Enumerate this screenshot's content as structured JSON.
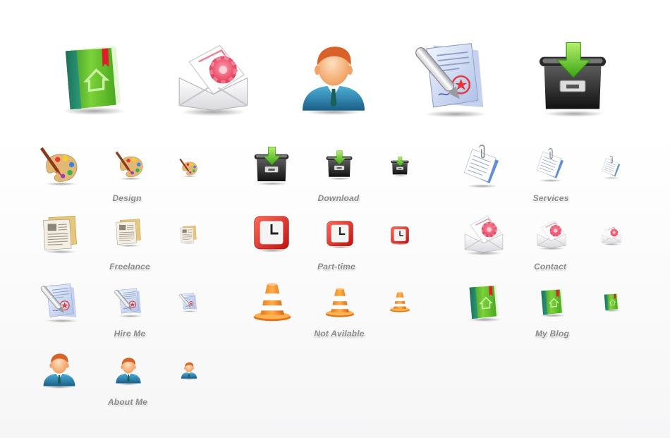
{
  "sheet": {
    "background": "#ffffff",
    "label_color": "#8c8c8c"
  },
  "featured": [
    {
      "icon": "green-book-icon"
    },
    {
      "icon": "envelope-flower-icon"
    },
    {
      "icon": "businessman-icon"
    },
    {
      "icon": "document-pen-icon"
    },
    {
      "icon": "download-box-icon"
    }
  ],
  "groups": [
    {
      "label": "Design",
      "icon": "paint-palette-icon"
    },
    {
      "label": "Download",
      "icon": "download-box-icon"
    },
    {
      "label": "Services",
      "icon": "paper-clip-document-icon"
    },
    {
      "label": "Freelance",
      "icon": "newspaper-icon"
    },
    {
      "label": "Part-time",
      "icon": "clock-icon"
    },
    {
      "label": "Contact",
      "icon": "envelope-flower-icon"
    },
    {
      "label": "Hire Me",
      "icon": "document-pen-icon"
    },
    {
      "label": "Not Avilable",
      "icon": "traffic-cone-icon"
    },
    {
      "label": "My Blog",
      "icon": "green-book-icon"
    },
    {
      "label": "About Me",
      "icon": "businessman-icon"
    }
  ]
}
